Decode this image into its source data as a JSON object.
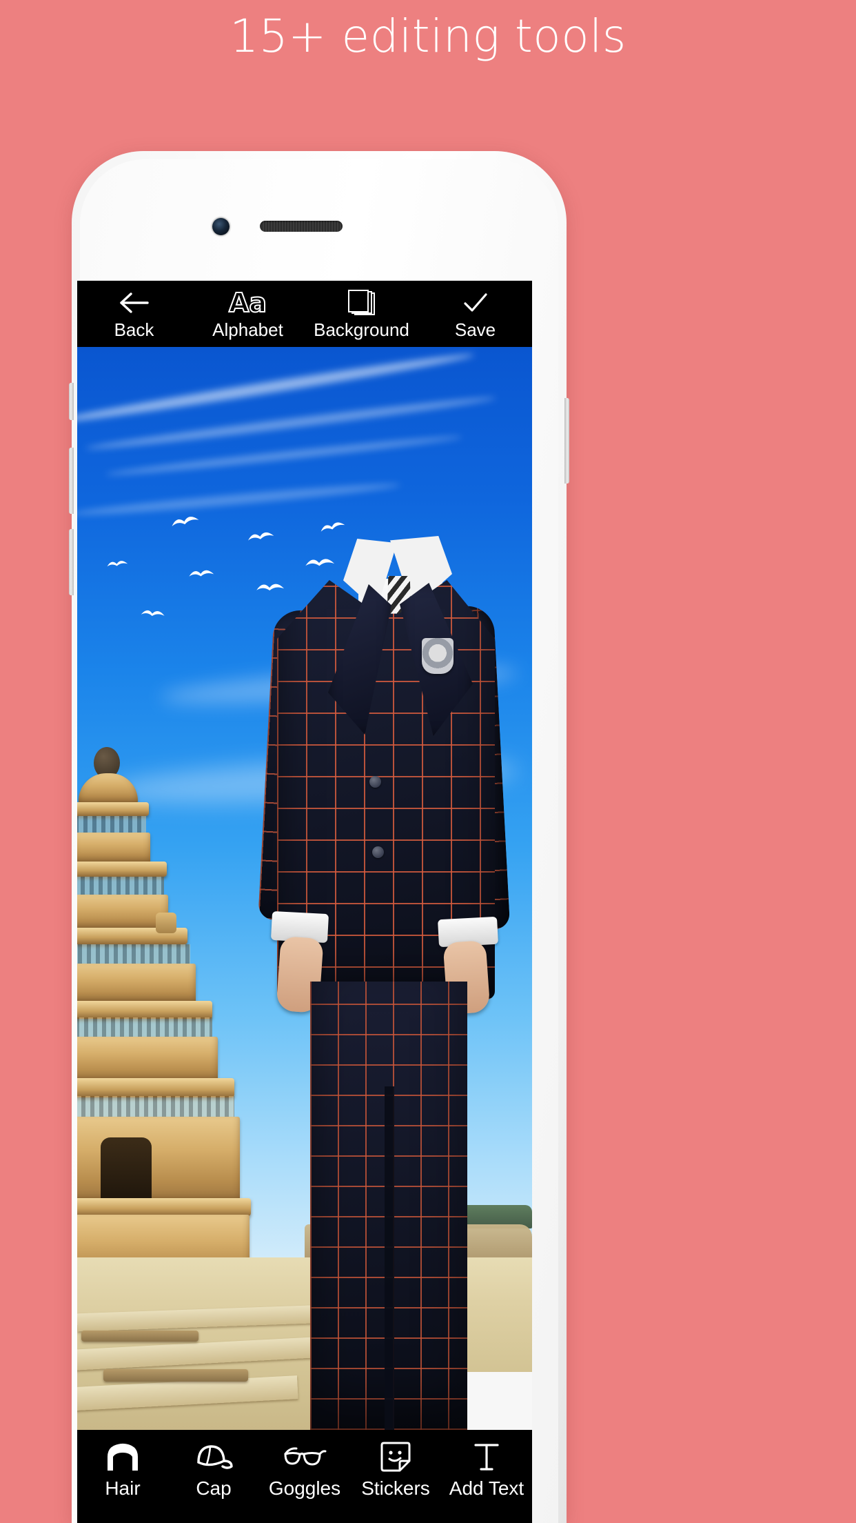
{
  "headline": "15+ editing tools",
  "colors": {
    "background": "#ed8080",
    "toolbar_bg": "#000000",
    "toolbar_text": "#ffffff",
    "phone_body": "#f7f7f7",
    "sky_top": "#0a56d0",
    "sky_bottom": "#d8eefb",
    "suit_navy": "#141829",
    "suit_check": "#d65c3e",
    "temple_stone": "#d6ae6a"
  },
  "phone": {
    "front_camera_icon": "front-camera",
    "earpiece_icon": "earpiece-speaker"
  },
  "topbar": {
    "items": [
      {
        "label": "Back",
        "icon": "arrow-left-icon"
      },
      {
        "label": "Alphabet",
        "icon": "aa-text-icon"
      },
      {
        "label": "Background",
        "icon": "layers-icon"
      },
      {
        "label": "Save",
        "icon": "check-icon"
      }
    ]
  },
  "bottombar": {
    "items": [
      {
        "label": "Hair",
        "icon": "hair-icon"
      },
      {
        "label": "Cap",
        "icon": "cap-icon"
      },
      {
        "label": "Goggles",
        "icon": "goggles-icon"
      },
      {
        "label": "Stickers",
        "icon": "sticker-smiley-icon"
      },
      {
        "label": "Add Text",
        "icon": "text-t-icon"
      }
    ]
  },
  "canvas": {
    "description": "photo-editor-preview",
    "scene": "stone temple with blue sky, flying birds and a headless man in a navy checked suit",
    "birds_count": 8
  }
}
